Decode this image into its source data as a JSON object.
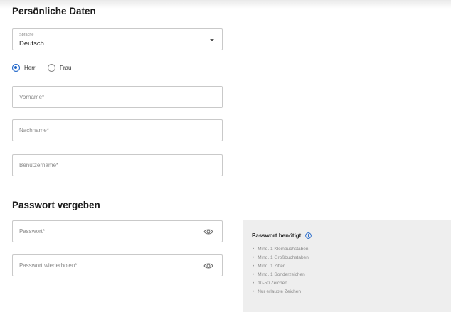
{
  "section_personal": {
    "title": "Persönliche Daten"
  },
  "language": {
    "label": "Sprache",
    "value": "Deutsch"
  },
  "salutation": {
    "options": [
      {
        "label": "Herr",
        "selected": true
      },
      {
        "label": "Frau",
        "selected": false
      }
    ]
  },
  "fields": {
    "first_name": "Vorname*",
    "last_name": "Nachname*",
    "username": "Benutzername*"
  },
  "section_password": {
    "title": "Passwort vergeben"
  },
  "password": {
    "placeholder": "Passwort*",
    "repeat_placeholder": "Passwort wiederholen*"
  },
  "requirements": {
    "title": "Passwort benötigt",
    "items": [
      "Mind. 1 Kleinbuchstaben",
      "Mind. 1 Großbuchstaben",
      "Mind. 1 Ziffer",
      "Mind. 1 Sonderzeichen",
      "10-50 Zeichen",
      "Nur erlaubte Zeichen"
    ]
  },
  "colors": {
    "accent": "#1a62c8",
    "panel": "#eeeeee",
    "border": "#c9c9c9"
  },
  "icons": {
    "eye": "eye-icon",
    "info": "info-icon",
    "dropdown": "chevron-down-icon"
  }
}
